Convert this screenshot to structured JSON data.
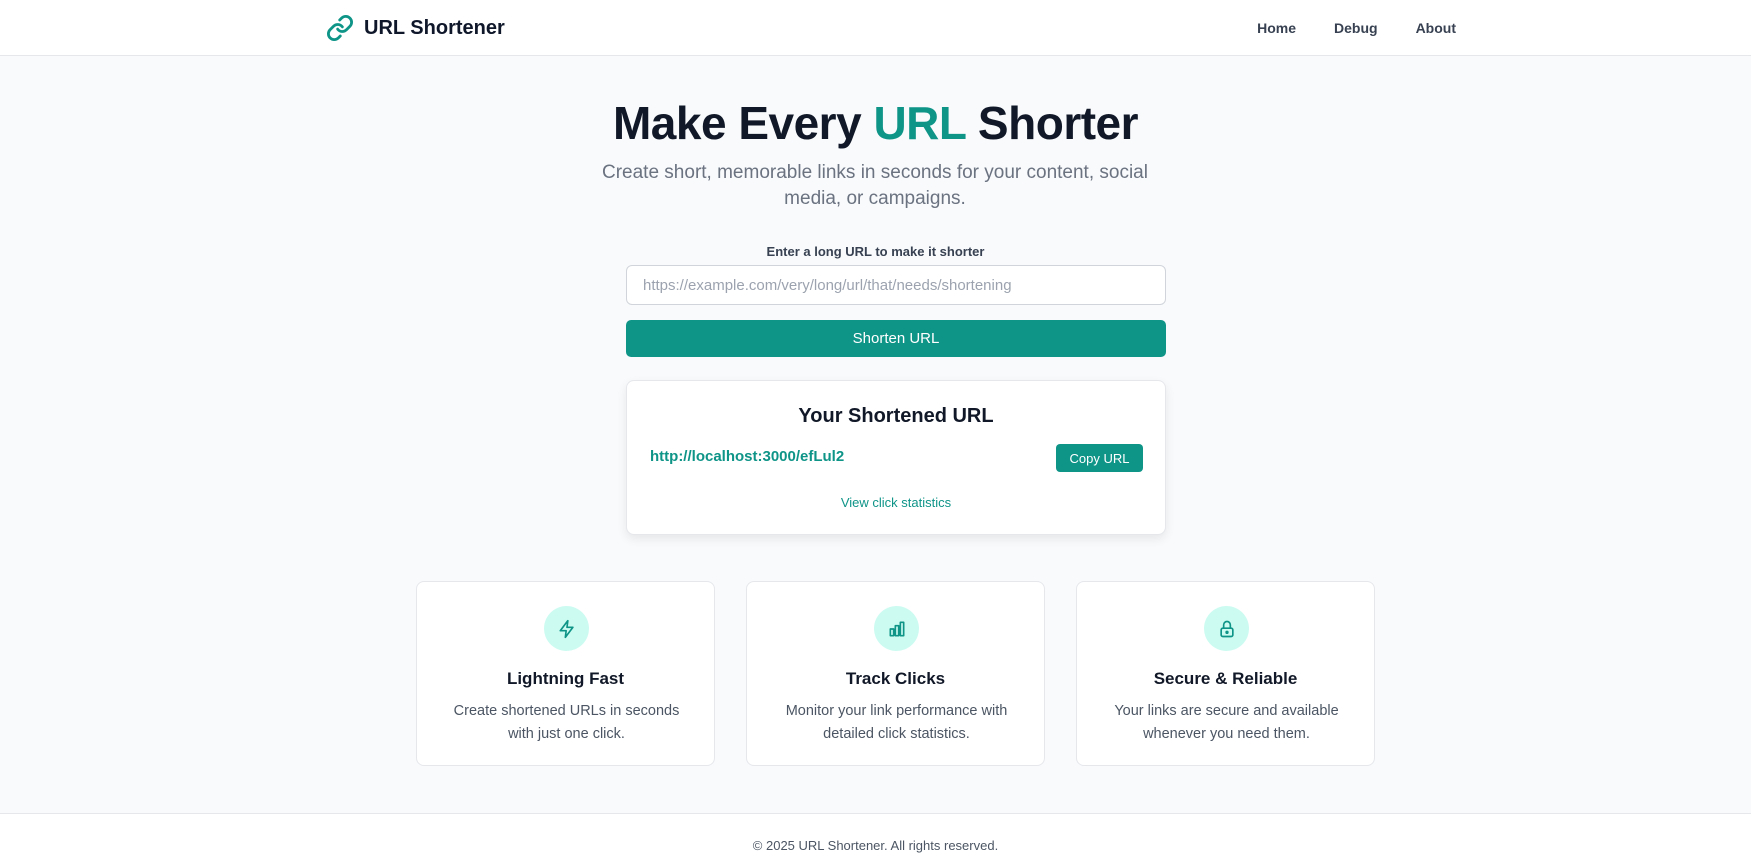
{
  "app": {
    "brand_icon": "link-icon",
    "brand_name": "URL Shortener"
  },
  "nav": {
    "items": [
      {
        "label": "Home"
      },
      {
        "label": "Debug"
      },
      {
        "label": "About"
      }
    ]
  },
  "hero": {
    "title_prefix": "Make Every ",
    "title_accent": "URL",
    "title_suffix": " Shorter",
    "subtitle": "Create short, memorable links in seconds for your content, social media, or campaigns."
  },
  "form": {
    "label": "Enter a long URL to make it shorter",
    "input_value": "",
    "input_placeholder": "https://example.com/very/long/url/that/needs/shortening",
    "submit_label": "Shorten URL"
  },
  "result": {
    "title": "Your Shortened URL",
    "short_url": "http://localhost:3000/efLul2",
    "copy_label": "Copy URL",
    "stats_link": "View click statistics"
  },
  "features": [
    {
      "icon": "lightning-bolt-icon",
      "title": "Lightning Fast",
      "description": "Create shortened URLs in seconds with just one click."
    },
    {
      "icon": "bar-chart-icon",
      "title": "Track Clicks",
      "description": "Monitor your link performance with detailed click statistics."
    },
    {
      "icon": "lock-icon",
      "title": "Secure & Reliable",
      "description": "Your links are secure and available whenever you need them."
    }
  ],
  "footer": {
    "text": "© 2025 URL Shortener. All rights reserved."
  },
  "colors": {
    "accent": "#0f9488",
    "accent_light": "#ccfbf1",
    "text_dark": "#111827",
    "text_muted": "#6b7280",
    "background": "#f8fafc"
  }
}
